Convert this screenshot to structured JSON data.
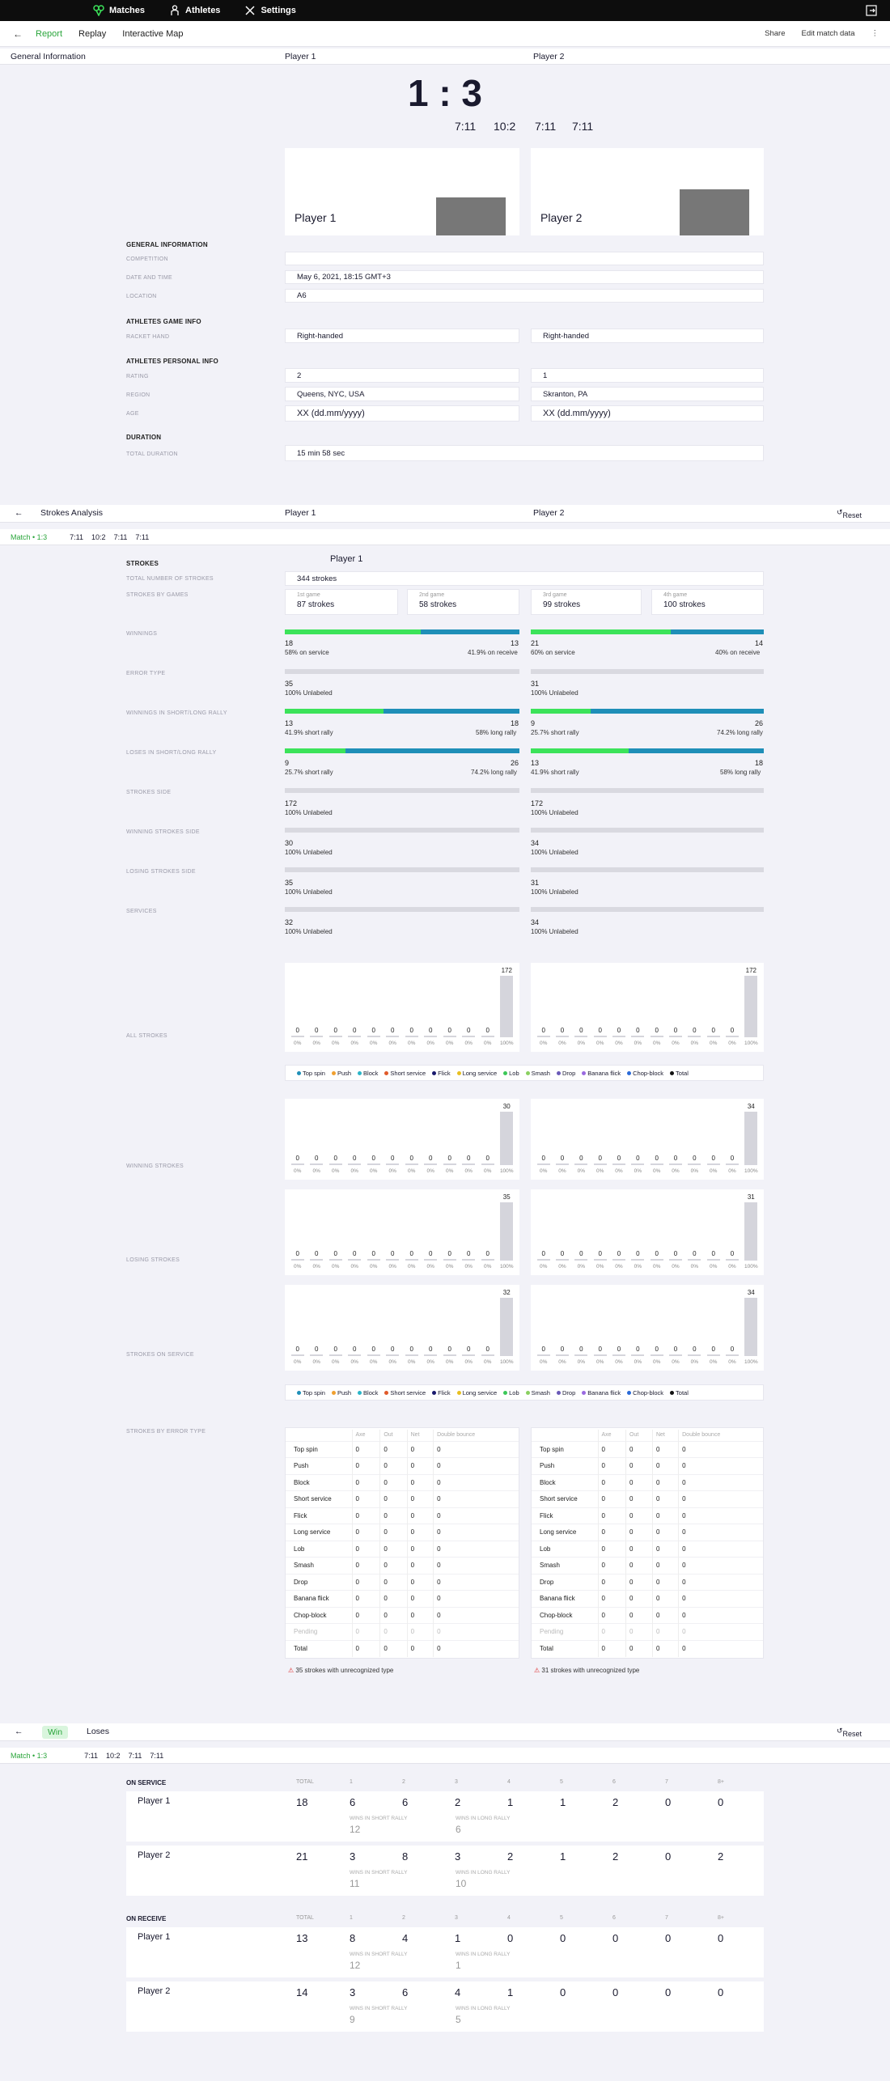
{
  "nav": {
    "matches": "Matches",
    "athletes": "Athletes",
    "settings": "Settings"
  },
  "tabs": {
    "report": "Report",
    "replay": "Replay",
    "map": "Interactive Map",
    "share": "Share",
    "edit": "Edit match data"
  },
  "general": {
    "title": "General Information",
    "p1": "Player 1",
    "p2": "Player 2",
    "score": "1 : 3",
    "games": [
      "7:11",
      "10:2",
      "7:11",
      "7:11"
    ],
    "card_p1": "Player 1",
    "card_p2": "Player 2",
    "sec_general": "GENERAL INFORMATION",
    "lbl_competition": "COMPETITION",
    "lbl_date": "DATE AND TIME",
    "date": "May 6, 2021, 18:15 GMT+3",
    "lbl_location": "LOCATION",
    "location": "A6",
    "sec_game": "ATHLETES GAME INFO",
    "lbl_hand": "RACKET HAND",
    "hand1": "Right-handed",
    "hand2": "Right-handed",
    "sec_personal": "ATHLETES PERSONAL INFO",
    "lbl_rating": "RATING",
    "rating1": "2",
    "rating2": "1",
    "lbl_region": "REGION",
    "region1": "Queens, NYC, USA",
    "region2": "Skranton, PA",
    "lbl_age": "AGE",
    "age1": "XX (dd.mm/yyyy)",
    "age2": "XX (dd.mm/yyyy)",
    "sec_duration": "DURATION",
    "lbl_total": "TOTAL DURATION",
    "duration": "15 min 58 sec"
  },
  "strokes": {
    "title": "Strokes Analysis",
    "p1": "Player 1",
    "p2": "Player 2",
    "reset": "Reset",
    "match": "Match • 1:3",
    "games": [
      "7:11",
      "10:2",
      "7:11",
      "7:11"
    ],
    "player_label": "Player 1",
    "sec": "STROKES",
    "lbl_total": "TOTAL NUMBER OF STROKES",
    "total": "344 strokes",
    "lbl_bygames": "STROKES BY GAMES",
    "g1l": "1st game",
    "g1": "87 strokes",
    "g2l": "2nd game",
    "g2": "58 strokes",
    "g3l": "3rd game",
    "g3": "99 strokes",
    "g4l": "4th game",
    "g4": "100 strokes",
    "lbl_winnings": "WINNINGS",
    "lbl_error": "ERROR TYPE",
    "lbl_wsl": "WINNINGS IN SHORT/LONG RALLY",
    "lbl_lsl": "LOSES IN SHORT/LONG RALLY",
    "lbl_side": "STROKES SIDE",
    "lbl_wside": "WINNING STROKES SIDE",
    "lbl_lside": "LOSING STROKES SIDE",
    "lbl_serv": "SERVICES",
    "w1a": "18",
    "w1b": "13",
    "w1sa": "58% on service",
    "w1sb": "41.9% on receive",
    "w2a": "21",
    "w2b": "14",
    "w2sa": "60% on service",
    "w2sb": "40% on receive",
    "e1": "35",
    "e2": "31",
    "unl": "100% Unlabeled",
    "ws1a": "13",
    "ws1b": "18",
    "ws1sa": "41.9% short rally",
    "ws1sb": "58% long rally",
    "ws2a": "9",
    "ws2b": "26",
    "ws2sa": "25.7% short rally",
    "ws2sb": "74.2% long rally",
    "ls1a": "9",
    "ls1b": "26",
    "ls1sa": "25.7% short rally",
    "ls1sb": "74.2% long rally",
    "ls2a": "13",
    "ls2b": "18",
    "ls2sa": "41.9% short rally",
    "ls2sb": "58% long rally",
    "side1": "172",
    "side2": "172",
    "wside1": "30",
    "wside2": "34",
    "lside1": "35",
    "lside2": "31",
    "serv1": "32",
    "serv2": "34",
    "lbl_all": "ALL STROKES",
    "lbl_win": "WINNING STROKES",
    "lbl_lose": "LOSING STROKES",
    "lbl_onserv": "STROKES ON SERVICE",
    "lbl_byerr": "STROKES BY ERROR TYPE",
    "warn1": "35 strokes with unrecognized type",
    "warn2": "31 strokes with unrecognized type"
  },
  "legend": [
    {
      "n": "Top spin",
      "c": "#1f8fb8"
    },
    {
      "n": "Push",
      "c": "#f0a030"
    },
    {
      "n": "Block",
      "c": "#2bb5c8"
    },
    {
      "n": "Short service",
      "c": "#e05a2a"
    },
    {
      "n": "Flick",
      "c": "#1a1a6e"
    },
    {
      "n": "Long service",
      "c": "#e8c020"
    },
    {
      "n": "Lob",
      "c": "#3cc858"
    },
    {
      "n": "Smash",
      "c": "#8ad060"
    },
    {
      "n": "Drop",
      "c": "#6a5ab8"
    },
    {
      "n": "Banana flick",
      "c": "#9a6ae0"
    },
    {
      "n": "Chop-block",
      "c": "#2a6ad8"
    },
    {
      "n": "Total",
      "c": "#111111"
    }
  ],
  "chart_data": [
    {
      "type": "bar",
      "title": "ALL STROKES",
      "series": [
        {
          "name": "Player 1",
          "values": [
            0,
            0,
            0,
            0,
            0,
            0,
            0,
            0,
            0,
            0,
            0,
            172
          ]
        },
        {
          "name": "Player 2",
          "values": [
            0,
            0,
            0,
            0,
            0,
            0,
            0,
            0,
            0,
            0,
            0,
            172
          ]
        }
      ],
      "pct": [
        "0%",
        "0%",
        "0%",
        "0%",
        "0%",
        "0%",
        "0%",
        "0%",
        "0%",
        "0%",
        "0%",
        "100%"
      ]
    },
    {
      "type": "bar",
      "title": "WINNING STROKES",
      "series": [
        {
          "name": "Player 1",
          "values": [
            0,
            0,
            0,
            0,
            0,
            0,
            0,
            0,
            0,
            0,
            0,
            30
          ]
        },
        {
          "name": "Player 2",
          "values": [
            0,
            0,
            0,
            0,
            0,
            0,
            0,
            0,
            0,
            0,
            0,
            34
          ]
        }
      ],
      "pct": [
        "0%",
        "0%",
        "0%",
        "0%",
        "0%",
        "0%",
        "0%",
        "0%",
        "0%",
        "0%",
        "0%",
        "100%"
      ]
    },
    {
      "type": "bar",
      "title": "LOSING STROKES",
      "series": [
        {
          "name": "Player 1",
          "values": [
            0,
            0,
            0,
            0,
            0,
            0,
            0,
            0,
            0,
            0,
            0,
            35
          ]
        },
        {
          "name": "Player 2",
          "values": [
            0,
            0,
            0,
            0,
            0,
            0,
            0,
            0,
            0,
            0,
            0,
            31
          ]
        }
      ],
      "pct": [
        "0%",
        "0%",
        "0%",
        "0%",
        "0%",
        "0%",
        "0%",
        "0%",
        "0%",
        "0%",
        "0%",
        "100%"
      ]
    },
    {
      "type": "bar",
      "title": "STROKES ON SERVICE",
      "series": [
        {
          "name": "Player 1",
          "values": [
            0,
            0,
            0,
            0,
            0,
            0,
            0,
            0,
            0,
            0,
            0,
            32
          ]
        },
        {
          "name": "Player 2",
          "values": [
            0,
            0,
            0,
            0,
            0,
            0,
            0,
            0,
            0,
            0,
            0,
            34
          ]
        }
      ],
      "pct": [
        "0%",
        "0%",
        "0%",
        "0%",
        "0%",
        "0%",
        "0%",
        "0%",
        "0%",
        "0%",
        "0%",
        "100%"
      ]
    }
  ],
  "error_table": {
    "cols": [
      "Axe",
      "Out",
      "Net",
      "Double bounce"
    ],
    "rows": [
      "Top spin",
      "Push",
      "Block",
      "Short service",
      "Flick",
      "Long service",
      "Lob",
      "Smash",
      "Drop",
      "Banana flick",
      "Chop-block",
      "Pending",
      "Total"
    ]
  },
  "winlose": {
    "win": "Win",
    "lose": "Loses",
    "reset": "Reset",
    "match": "Match • 1:3",
    "games": [
      "7:11",
      "10:2",
      "7:11",
      "7:11"
    ],
    "on_service": "ON SERVICE",
    "on_receive": "ON RECEIVE",
    "total": "TOTAL",
    "cols": [
      "1",
      "2",
      "3",
      "4",
      "5",
      "6",
      "7",
      "8+"
    ],
    "wsr": "WINS IN SHORT RALLY",
    "wlr": "WINS IN LONG RALLY",
    "service": [
      {
        "name": "Player 1",
        "total": "18",
        "v": [
          "6",
          "6",
          "2",
          "1",
          "1",
          "2",
          "0",
          "0"
        ],
        "sr": "12",
        "lr": "6"
      },
      {
        "name": "Player 2",
        "total": "21",
        "v": [
          "3",
          "8",
          "3",
          "2",
          "1",
          "2",
          "0",
          "2"
        ],
        "sr": "11",
        "lr": "10"
      }
    ],
    "receive": [
      {
        "name": "Player 1",
        "total": "13",
        "v": [
          "8",
          "4",
          "1",
          "0",
          "0",
          "0",
          "0",
          "0"
        ],
        "sr": "12",
        "lr": "1"
      },
      {
        "name": "Player 2",
        "total": "14",
        "v": [
          "3",
          "6",
          "4",
          "1",
          "0",
          "0",
          "0",
          "0"
        ],
        "sr": "9",
        "lr": "5"
      }
    ]
  }
}
